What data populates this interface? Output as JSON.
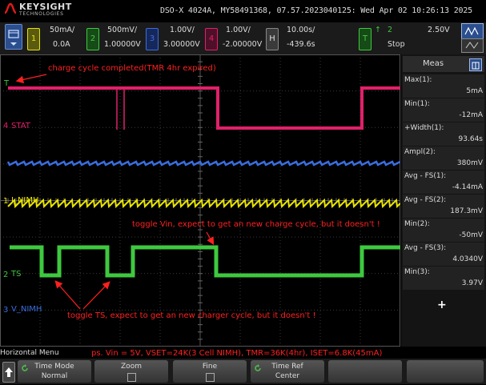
{
  "brand": {
    "name": "KEYSIGHT",
    "sub": "TECHNOLOGIES"
  },
  "title": "DSO-X 4024A, MY58491368, 07.57.2023040125: Wed Apr 02 10:26:13 2025",
  "channels": [
    {
      "num": "1",
      "scale": "50mA/",
      "offset": "0.0A",
      "color": "#e8e400"
    },
    {
      "num": "2",
      "scale": "500mV/",
      "offset": "1.00000V",
      "color": "#3ec93e"
    },
    {
      "num": "3",
      "scale": "1.00V/",
      "offset": "3.00000V",
      "color": "#3a6de0"
    },
    {
      "num": "4",
      "scale": "1.00V/",
      "offset": "-2.00000V",
      "color": "#e0206a"
    }
  ],
  "horizontal": {
    "letter": "H",
    "scale": "10.00s/",
    "delay": "-439.6s"
  },
  "trigger": {
    "letter": "T",
    "edge": "↑",
    "source": "2",
    "level": "2.50V",
    "state": "Stop"
  },
  "trace_labels": {
    "stat": "STAT",
    "i_nimh": "I_NIMH",
    "ts": "TS",
    "v_nimh": "V_NIMH"
  },
  "marker_labels": {
    "ch1": "1",
    "ch2": "2",
    "ch3": "3",
    "ch4": "4",
    "trig": "T"
  },
  "annotations": {
    "charge_done": "charge cycle completed(TMR 4hr expired)",
    "toggle_vin": "toggle Vin, expect to get an new charge cycle, but it doesn't !",
    "toggle_ts": "toggle TS, expect to get an new charger cycle, but it doesn't !",
    "footnote": "ps.  Vin = 5V, VSET=24K(3 Cell NIMH), TMR=36K(4hr), ISET=6.8K(45mA)"
  },
  "meas": {
    "title": "Meas",
    "items": [
      {
        "label": "Max(1):",
        "value": "5mA"
      },
      {
        "label": "Min(1):",
        "value": "-12mA"
      },
      {
        "label": "+Width(1):",
        "value": "93.64s"
      },
      {
        "label": "Ampl(2):",
        "value": "380mV"
      },
      {
        "label": "Avg - FS(1):",
        "value": "-4.14mA"
      },
      {
        "label": "Avg - FS(2):",
        "value": "187.3mV"
      },
      {
        "label": "Min(2):",
        "value": "-50mV"
      },
      {
        "label": "Avg - FS(3):",
        "value": "4.0340V"
      },
      {
        "label": "Min(3):",
        "value": "3.97V"
      }
    ],
    "add": "+"
  },
  "menu": {
    "title": "Horizontal Menu"
  },
  "softkeys": [
    {
      "label": "Time Mode",
      "value": "Normal"
    },
    {
      "label": "Zoom",
      "value": ""
    },
    {
      "label": "Fine",
      "value": ""
    },
    {
      "label": "Time Ref",
      "value": "Center"
    }
  ]
}
